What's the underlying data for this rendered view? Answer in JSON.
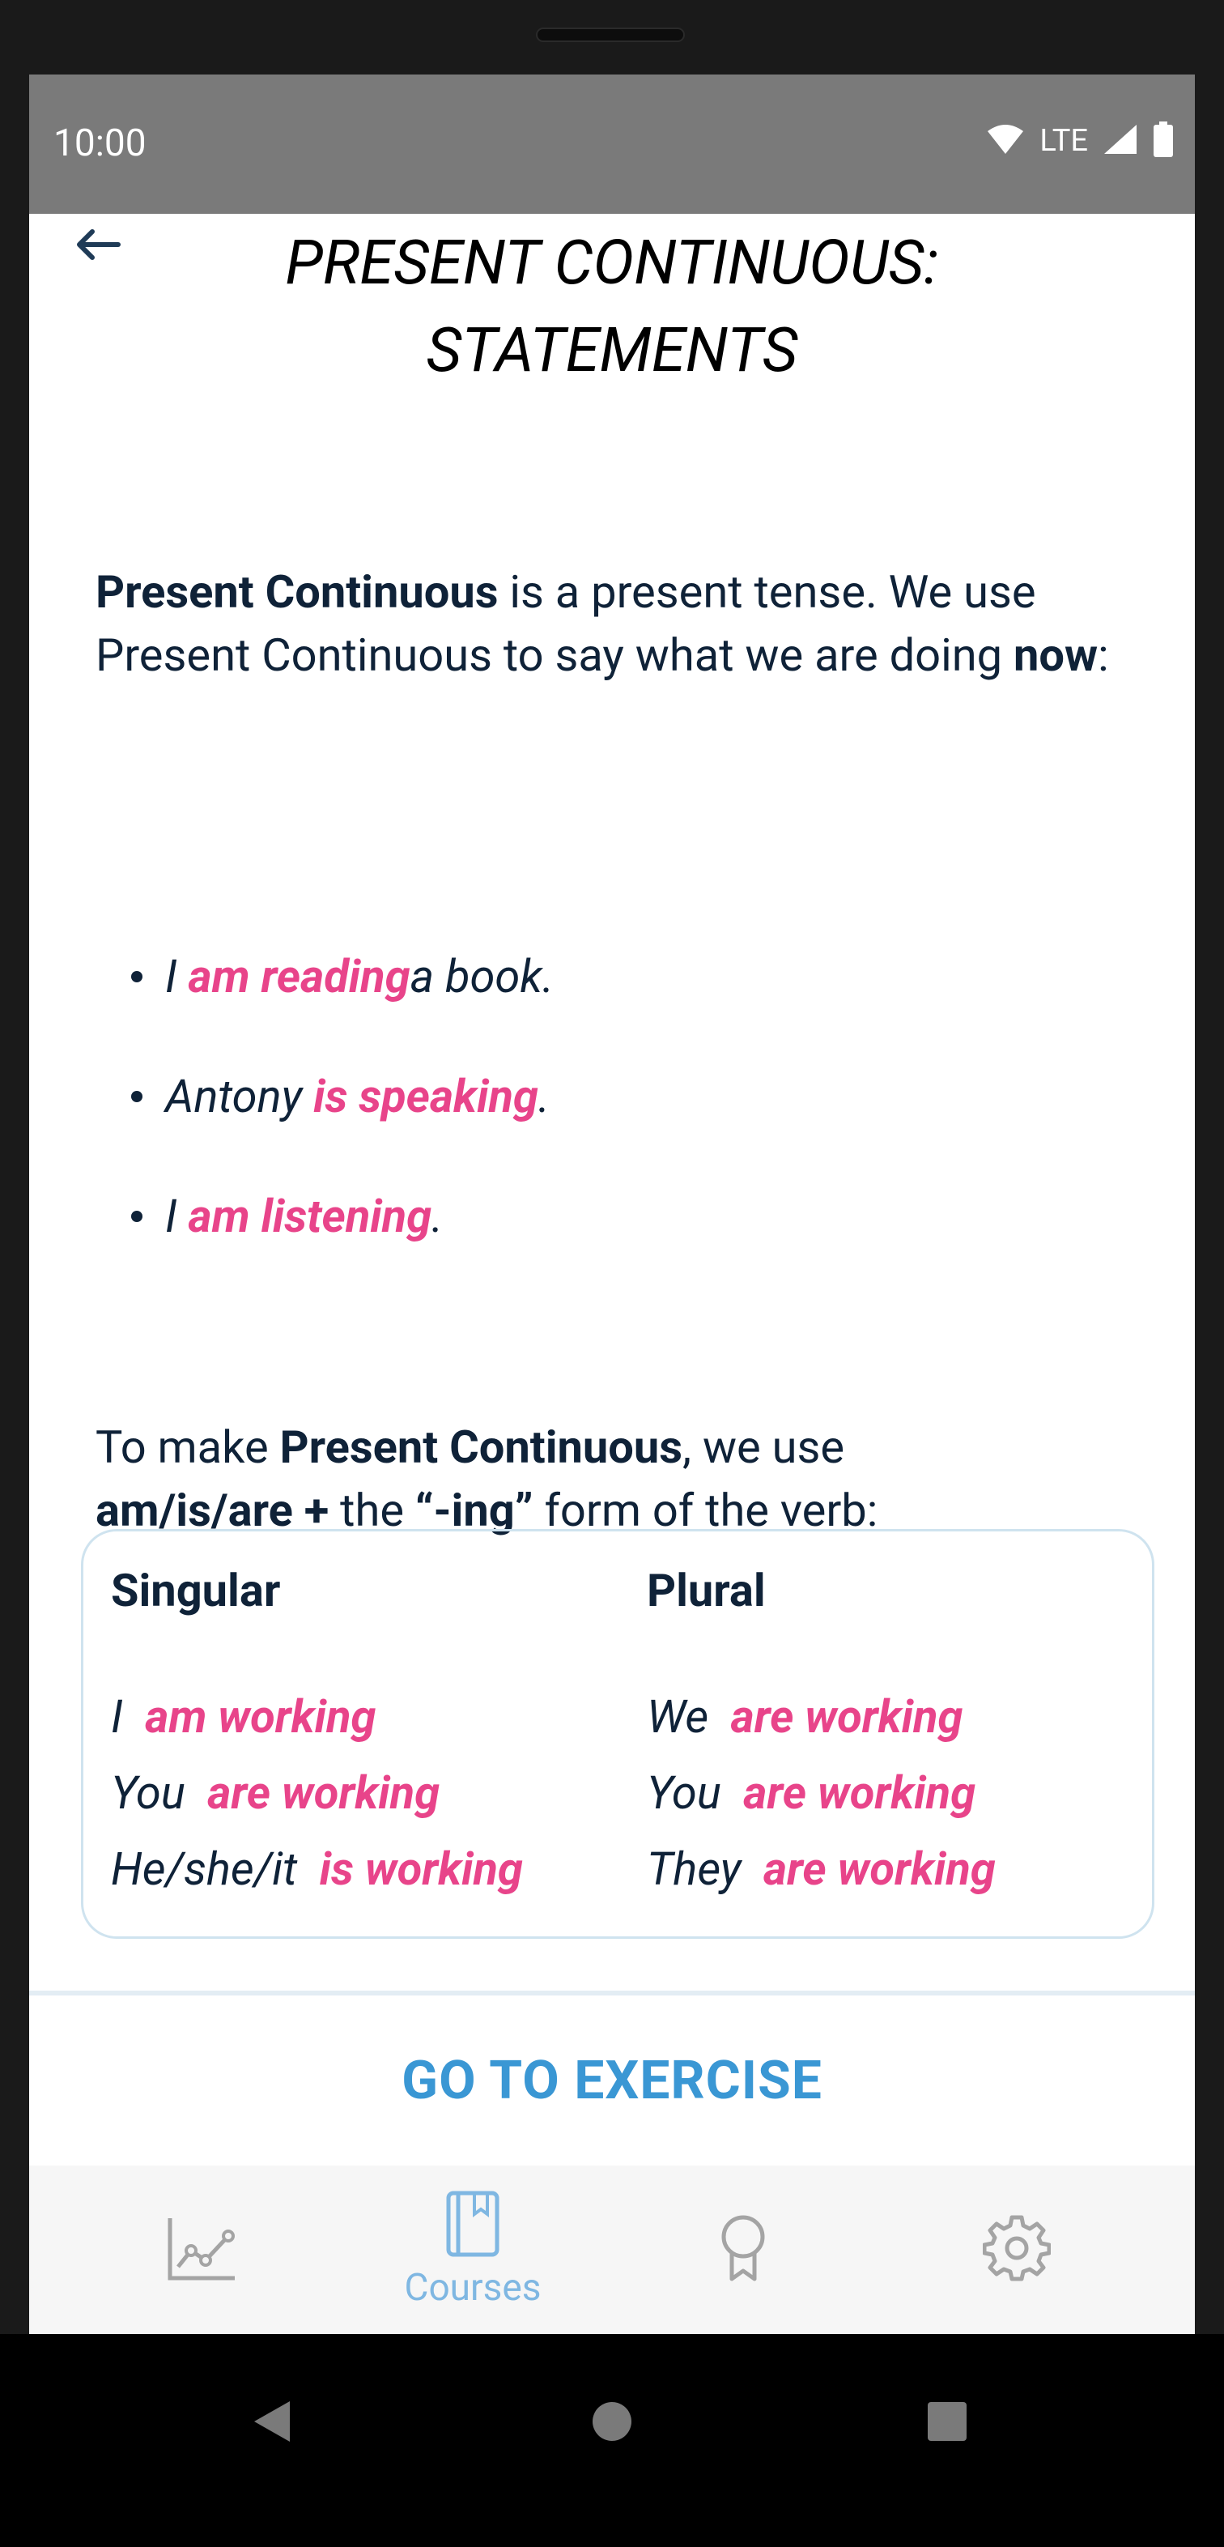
{
  "status_bar": {
    "time": "10:00",
    "network": "LTE",
    "icons": [
      "wifi-icon",
      "signal-icon",
      "battery-icon"
    ]
  },
  "header": {
    "back_icon": "arrow-left-icon",
    "title_line1": "PRESENT CONTINUOUS:",
    "title_line2": "STATEMENTS"
  },
  "intro": {
    "term": "Present Continuous",
    "text1": " is a present tense. We use Present Continuous to say what we are doing ",
    "emphasis": "now",
    "text2": ":"
  },
  "examples": [
    {
      "pre": "I ",
      "verb": "am reading",
      "post": " a book."
    },
    {
      "pre": "Antony ",
      "verb": "is speaking",
      "post": "."
    },
    {
      "pre": "I ",
      "verb": "am listening",
      "post": "."
    }
  ],
  "rule": {
    "text1": "To make ",
    "term": "Present Continuous",
    "text2": ", we use ",
    "formula": "am/is/are +",
    "text3": " the ",
    "ing": "“-ing”",
    "text4": " form of the verb:"
  },
  "table": {
    "singular_header": "Singular",
    "plural_header": "Plural",
    "singular": [
      {
        "subject": "I ",
        "verb": "am working"
      },
      {
        "subject": "You ",
        "verb": "are working"
      },
      {
        "subject": "He/she/it ",
        "verb": "is working"
      }
    ],
    "plural": [
      {
        "subject": "We ",
        "verb": "are working"
      },
      {
        "subject": "You ",
        "verb": "are working"
      },
      {
        "subject": "They ",
        "verb": "are working"
      }
    ]
  },
  "cta": {
    "label": "GO TO EXERCISE"
  },
  "bottom_nav": {
    "items": [
      {
        "icon": "chart-icon",
        "label": ""
      },
      {
        "icon": "book-icon",
        "label": "Courses",
        "active": true
      },
      {
        "icon": "award-icon",
        "label": ""
      },
      {
        "icon": "gear-icon",
        "label": ""
      }
    ]
  },
  "system_nav": {
    "icons": [
      "back-triangle-icon",
      "home-circle-icon",
      "recents-square-icon"
    ]
  },
  "colors": {
    "accent_pink": "#e8448a",
    "accent_blue": "#3a97d4",
    "text_navy": "#0f2238",
    "status_bar": "#7a7a7a"
  }
}
